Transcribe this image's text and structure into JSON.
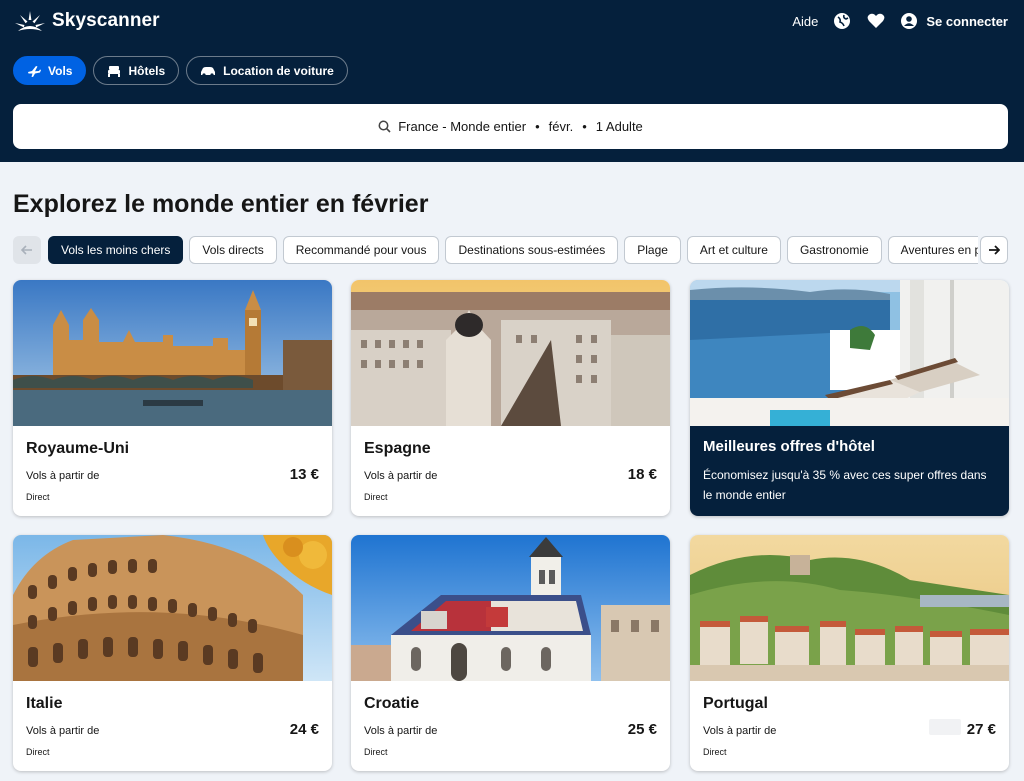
{
  "brand": {
    "name": "Skyscanner"
  },
  "topnav": {
    "help": "Aide",
    "login": "Se connecter",
    "icons": [
      "globe-icon",
      "heart-icon",
      "user-icon"
    ]
  },
  "tabs": [
    {
      "label": "Vols",
      "icon": "plane-icon",
      "active": true
    },
    {
      "label": "Hôtels",
      "icon": "bed-icon",
      "active": false
    },
    {
      "label": "Location de voiture",
      "icon": "car-icon",
      "active": false
    }
  ],
  "search": {
    "origin": "France - Monde entier",
    "date": "févr.",
    "travellers": "1 Adulte",
    "sep": "•"
  },
  "page": {
    "title": "Explorez le monde entier en février"
  },
  "chips": [
    {
      "label": "Vols les moins chers",
      "active": true
    },
    {
      "label": "Vols directs"
    },
    {
      "label": "Recommandé pour vous"
    },
    {
      "label": "Destinations sous-estimées"
    },
    {
      "label": "Plage"
    },
    {
      "label": "Art et culture"
    },
    {
      "label": "Gastronomie"
    },
    {
      "label": "Aventures en plein air"
    }
  ],
  "cards": [
    {
      "name": "Royaume-Uni",
      "from": "Vols à partir de",
      "price": "13 €",
      "direct": "Direct"
    },
    {
      "name": "Espagne",
      "from": "Vols à partir de",
      "price": "18 €",
      "direct": "Direct"
    },
    {
      "name": "Italie",
      "from": "Vols à partir de",
      "price": "24 €",
      "direct": "Direct"
    },
    {
      "name": "Croatie",
      "from": "Vols à partir de",
      "price": "25 €",
      "direct": "Direct"
    },
    {
      "name": "Portugal",
      "from": "Vols à partir de",
      "price": "27 €",
      "direct": "Direct"
    }
  ],
  "promo": {
    "title": "Meilleures offres d'hôtel",
    "text": "Économisez jusqu'à 35 % avec ces super offres dans le monde entier"
  },
  "colors": {
    "header": "#05203c",
    "accent": "#0062e3",
    "background": "#eff3f8"
  }
}
